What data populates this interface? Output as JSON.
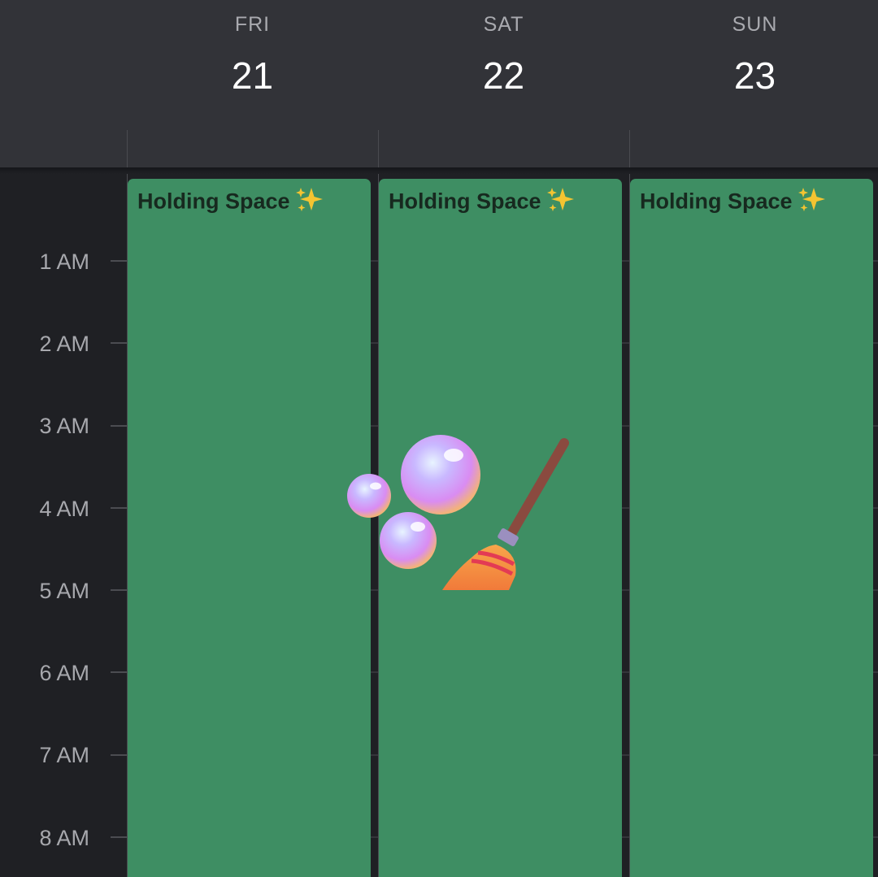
{
  "days": [
    {
      "name": "FRI",
      "number": "21"
    },
    {
      "name": "SAT",
      "number": "22"
    },
    {
      "name": "SUN",
      "number": "23"
    }
  ],
  "hours": [
    "1 AM",
    "2 AM",
    "3 AM",
    "4 AM",
    "5 AM",
    "6 AM",
    "7 AM",
    "8 AM"
  ],
  "events": [
    {
      "title": "Holding Space",
      "icon": "sparkles-icon"
    },
    {
      "title": "Holding Space",
      "icon": "sparkles-icon"
    },
    {
      "title": "Holding Space",
      "icon": "sparkles-icon"
    }
  ],
  "overlay": {
    "icons": [
      "bubbles-icon",
      "broom-icon"
    ]
  },
  "colors": {
    "header_bg": "#323338",
    "body_bg": "#1f2024",
    "event_bg": "#3e8e63",
    "event_text": "#17291f"
  }
}
